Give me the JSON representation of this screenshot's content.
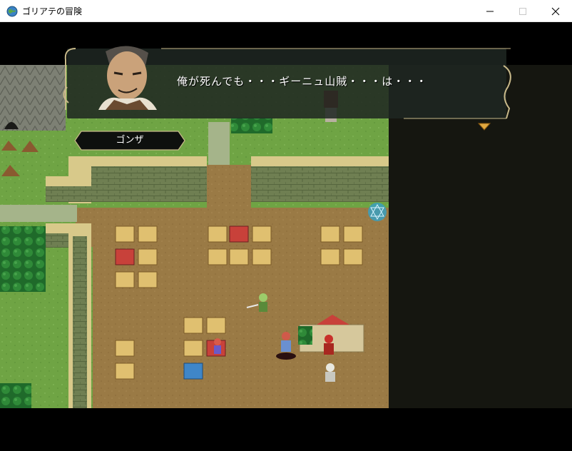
{
  "window": {
    "title": "ゴリアテの冒険",
    "icon": "globe-app-icon",
    "controls": [
      "minimize-icon",
      "maximize-icon",
      "close-icon"
    ]
  },
  "dialogue": {
    "speaker": "ゴンザ",
    "message": "俺が死んでも・・・ギーニュ山賊・・・は・・・",
    "continue_indicator": "triangle-down-icon"
  },
  "colors": {
    "grass": "#6fa444",
    "dirt": "#9a7a45",
    "wall": "#6f7f52",
    "dialog_bg": "#1e2622",
    "gold_trim": "#c8b98a"
  }
}
